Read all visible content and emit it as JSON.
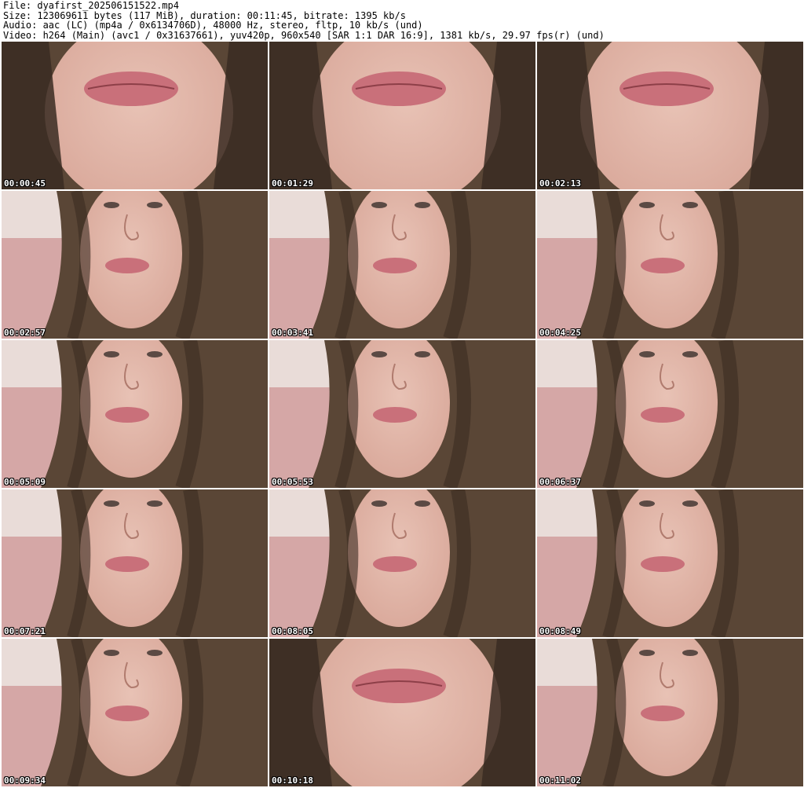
{
  "header": {
    "line1": "File: dyafirst_202506151522.mp4",
    "line2": "Size: 123069611 bytes (117 MiB), duration: 00:11:45, bitrate: 1395 kb/s",
    "line3": "Audio: aac (LC) (mp4a / 0x6134706D), 48000 Hz, stereo, fltp, 10 kb/s (und)",
    "line4": "Video: h264 (Main) (avc1 / 0x31637661), yuv420p, 960x540 [SAR 1:1 DAR 16:9], 1381 kb/s, 29.97 fps(r) (und)"
  },
  "colors": {
    "skin": "#d9a89a",
    "skin_light": "#e8c2b5",
    "hair": "#5a4636",
    "hair_dark": "#3a2c22",
    "lips": "#c9707a",
    "background_light": "#e9dcd8",
    "pillow": "#cf9a9a"
  },
  "frames": [
    {
      "timestamp": "00:00:45",
      "view": "closeup"
    },
    {
      "timestamp": "00:01:29",
      "view": "closeup"
    },
    {
      "timestamp": "00:02:13",
      "view": "closeup"
    },
    {
      "timestamp": "00:02:57",
      "view": "face"
    },
    {
      "timestamp": "00:03:41",
      "view": "face"
    },
    {
      "timestamp": "00:04:25",
      "view": "face"
    },
    {
      "timestamp": "00:05:09",
      "view": "face"
    },
    {
      "timestamp": "00:05:53",
      "view": "face"
    },
    {
      "timestamp": "00:06:37",
      "view": "face"
    },
    {
      "timestamp": "00:07:21",
      "view": "face"
    },
    {
      "timestamp": "00:08:05",
      "view": "face"
    },
    {
      "timestamp": "00:08:49",
      "view": "face"
    },
    {
      "timestamp": "00:09:34",
      "view": "face"
    },
    {
      "timestamp": "00:10:18",
      "view": "closeup"
    },
    {
      "timestamp": "00:11:02",
      "view": "face"
    }
  ]
}
